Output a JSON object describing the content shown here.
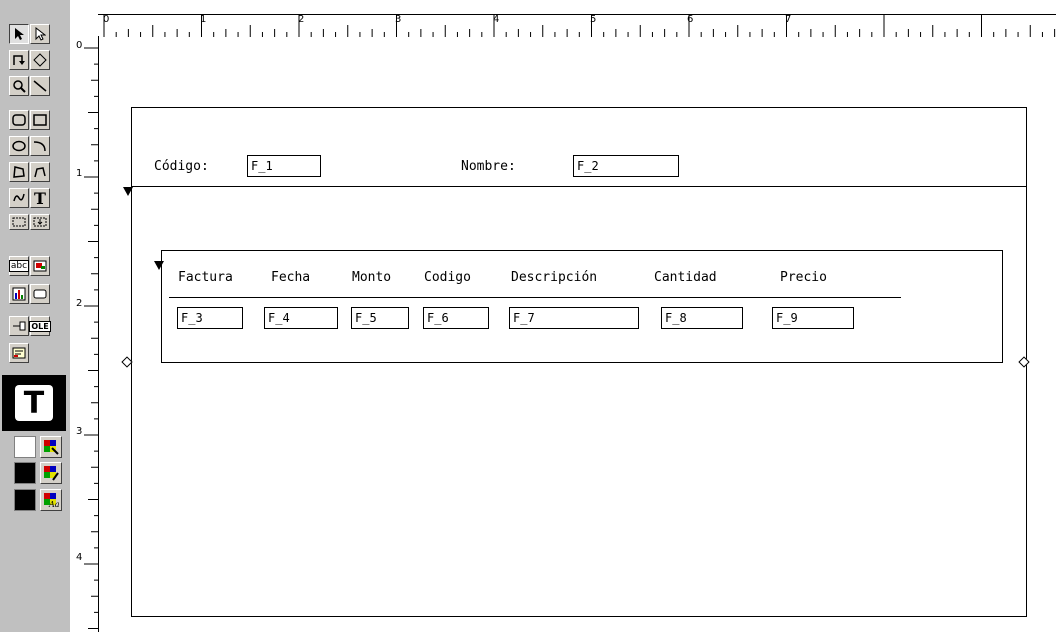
{
  "toolbar": {
    "tools": [
      {
        "name": "select",
        "icon": "arrow-select-icon"
      },
      {
        "name": "select-frame",
        "icon": "arrow-outline-icon"
      },
      {
        "name": "rotate",
        "icon": "rotate-icon"
      },
      {
        "name": "reshape",
        "icon": "reshape-icon"
      },
      {
        "name": "magnify",
        "icon": "magnify-icon"
      },
      {
        "name": "line",
        "icon": "line-icon"
      },
      {
        "name": "rounded-rect",
        "icon": "rounded-rect-icon"
      },
      {
        "name": "rectangle",
        "icon": "rectangle-icon"
      },
      {
        "name": "ellipse",
        "icon": "ellipse-icon"
      },
      {
        "name": "arc",
        "icon": "arc-icon"
      },
      {
        "name": "polygon",
        "icon": "polygon-icon"
      },
      {
        "name": "polyline",
        "icon": "polyline-icon"
      },
      {
        "name": "freehand",
        "icon": "freehand-icon"
      },
      {
        "name": "text",
        "icon": "text-icon",
        "glyph": "T"
      },
      {
        "name": "frame",
        "icon": "frame-icon"
      },
      {
        "name": "repeating-frame",
        "icon": "repeating-frame-icon"
      },
      {
        "name": "field",
        "icon": "field-icon",
        "glyph": "abc"
      },
      {
        "name": "image",
        "icon": "image-icon"
      },
      {
        "name": "chart",
        "icon": "chart-icon"
      },
      {
        "name": "button",
        "icon": "button-icon"
      },
      {
        "name": "link",
        "icon": "link-icon"
      },
      {
        "name": "ole",
        "icon": "ole-icon",
        "glyph": "OLE"
      },
      {
        "name": "formula",
        "icon": "formula-icon"
      }
    ],
    "big_text_glyph": "T"
  },
  "rulers": {
    "top_numbers": [
      "0",
      "1",
      "2",
      "3",
      "4",
      "5",
      "6",
      "7"
    ],
    "left_numbers": [
      "0",
      "1",
      "2",
      "3",
      "4"
    ]
  },
  "header": {
    "codigo_label": "Código:",
    "codigo_field": "F_1",
    "nombre_label": "Nombre:",
    "nombre_field": "F_2"
  },
  "detail": {
    "columns": [
      "Factura",
      "Fecha",
      "Monto",
      "Codigo",
      "Descripción",
      "Cantidad",
      "Precio"
    ],
    "fields": [
      "F_3",
      "F_4",
      "F_5",
      "F_6",
      "F_7",
      "F_8",
      "F_9"
    ]
  },
  "colors": {
    "palette_bg": "#c0c0c0",
    "canvas_bg": "#ffffff",
    "line": "#000000"
  }
}
